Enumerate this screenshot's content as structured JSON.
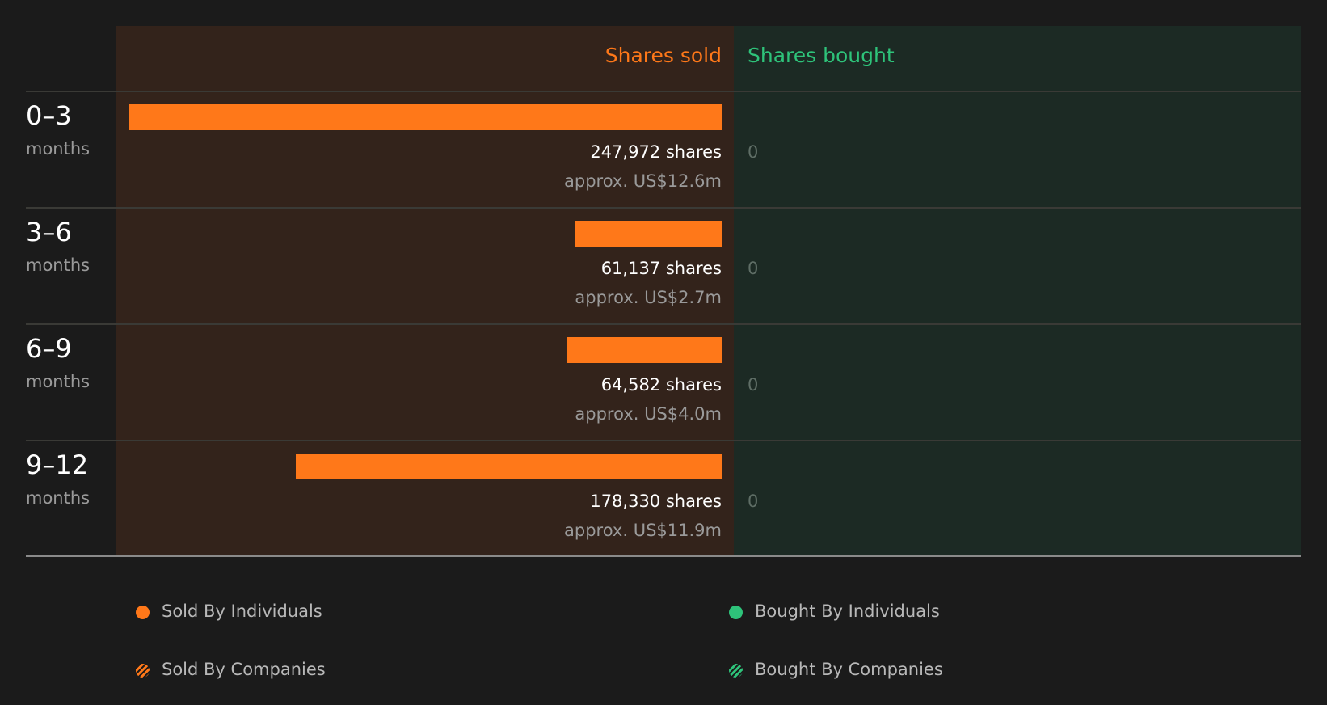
{
  "header": {
    "sold_label": "Shares sold",
    "bought_label": "Shares bought"
  },
  "colors": {
    "sold": "#ff7819",
    "bought": "#2ec37a",
    "background": "#1b1b1b"
  },
  "rows": [
    {
      "period": "0–3",
      "unit": "months",
      "shares_text": "247,972 shares",
      "approx_text": "approx. US$12.6m",
      "bought_text": "0"
    },
    {
      "period": "3–6",
      "unit": "months",
      "shares_text": "61,137 shares",
      "approx_text": "approx. US$2.7m",
      "bought_text": "0"
    },
    {
      "period": "6–9",
      "unit": "months",
      "shares_text": "64,582 shares",
      "approx_text": "approx. US$4.0m",
      "bought_text": "0"
    },
    {
      "period": "9–12",
      "unit": "months",
      "shares_text": "178,330 shares",
      "approx_text": "approx. US$11.9m",
      "bought_text": "0"
    }
  ],
  "legend": {
    "sold_individuals": "Sold By Individuals",
    "bought_individuals": "Bought By Individuals",
    "sold_companies": "Sold By Companies",
    "bought_companies": "Bought By Companies"
  },
  "chart_data": {
    "type": "bar",
    "categories": [
      "0–3 months",
      "3–6 months",
      "6–9 months",
      "9–12 months"
    ],
    "series": [
      {
        "name": "Shares sold",
        "values": [
          247972,
          61137,
          64582,
          178330
        ],
        "approx_value_usd_m": [
          12.6,
          2.7,
          4.0,
          11.9
        ]
      },
      {
        "name": "Shares bought",
        "values": [
          0,
          0,
          0,
          0
        ]
      }
    ],
    "legend_position": "bottom"
  }
}
